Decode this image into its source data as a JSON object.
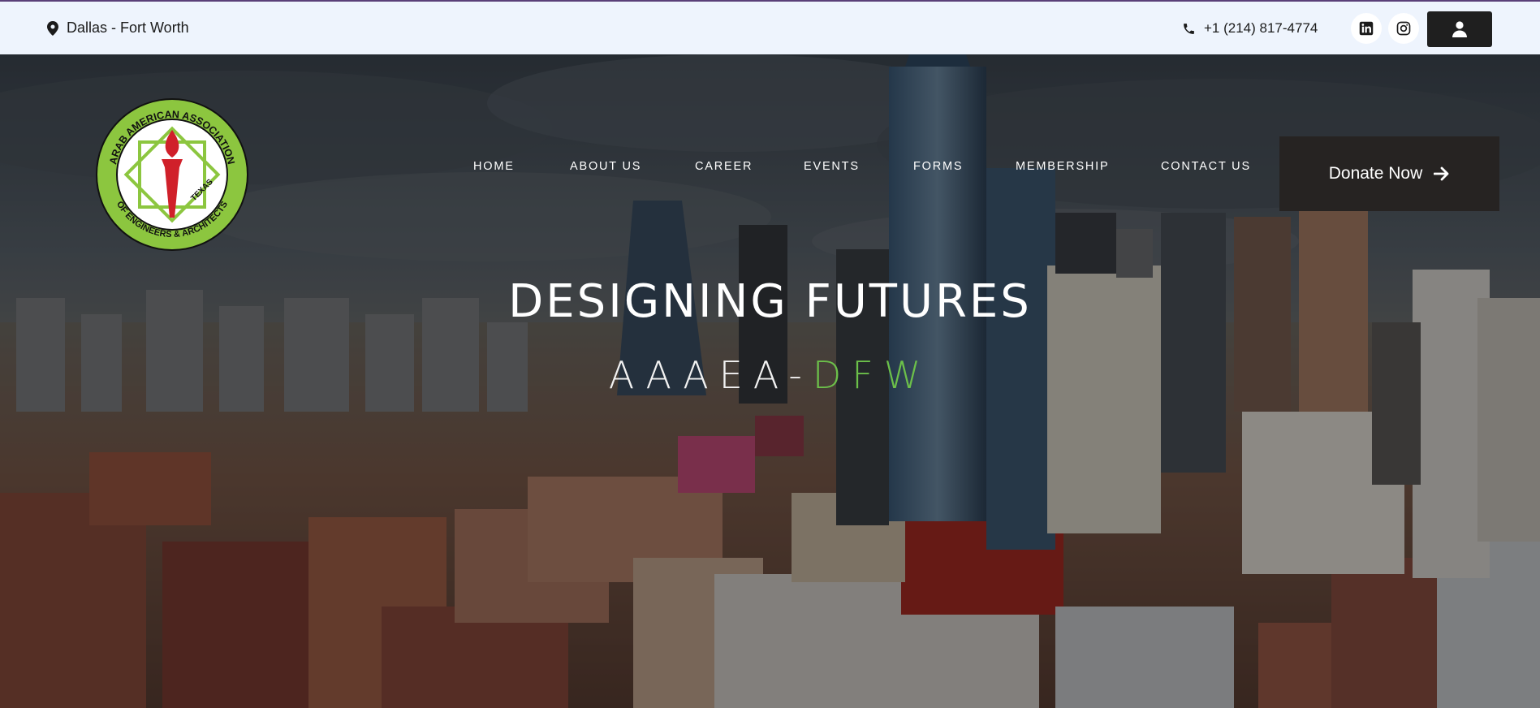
{
  "topbar": {
    "location": "Dallas - Fort Worth",
    "location_icon": "map-pin-icon",
    "phone": "+1 (214) 817-4774",
    "phone_icon": "phone-icon",
    "social": [
      {
        "name": "linkedin",
        "icon": "linkedin-icon"
      },
      {
        "name": "instagram",
        "icon": "instagram-icon"
      }
    ],
    "account_icon": "user-icon"
  },
  "logo": {
    "ring_text_top": "ARAB AMERICAN ASSOCIATION",
    "ring_text_bottom": "OF ENGINEERS & ARCHITECTS",
    "badge_text": "TEXAS",
    "ring_color": "#8cc63f",
    "torch_color": "#d0202a"
  },
  "nav": {
    "items": [
      "HOME",
      "ABOUT US",
      "CAREER",
      "EVENTS",
      "FORMS",
      "MEMBERSHIP",
      "CONTACT US"
    ]
  },
  "donate": {
    "label": "Donate Now",
    "icon": "arrow-right-icon"
  },
  "hero": {
    "headline": "DESIGNING FUTURES",
    "sub_white": "AAAEA-",
    "sub_green": "DFW",
    "accent_color": "#6cc04a"
  }
}
